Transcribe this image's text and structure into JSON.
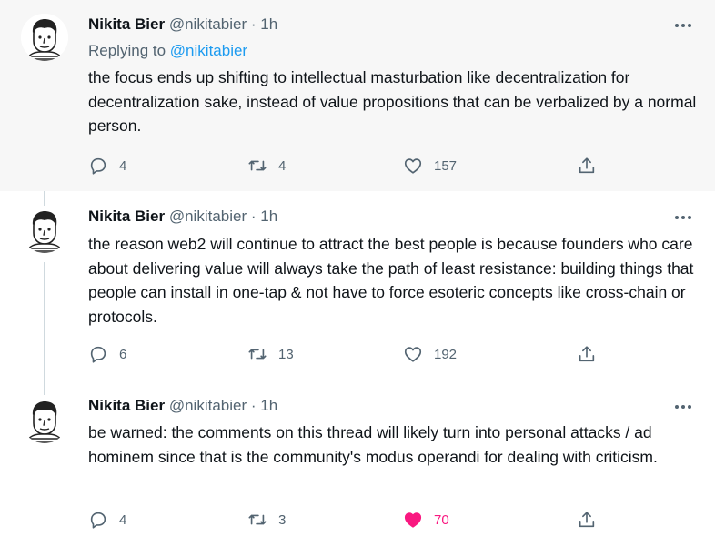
{
  "tweets": [
    {
      "author_name": "Nikita Bier",
      "handle": "@nikitabier",
      "separator": "·",
      "time": "1h",
      "replying_to_label": "Replying to",
      "replying_to_handle": "@nikitabier",
      "text": "the focus ends up shifting to intellectual masturbation like decentralization for decentralization sake, instead of value propositions that can be verbalized by a normal person.",
      "replies": "4",
      "retweets": "4",
      "likes": "157",
      "liked": false
    },
    {
      "author_name": "Nikita Bier",
      "handle": "@nikitabier",
      "separator": "·",
      "time": "1h",
      "text": "the reason web2 will continue to attract the best people is because founders who care about delivering value will always take the path of least resistance: building things that people can install in one-tap & not have to force esoteric concepts like cross-chain or protocols.",
      "replies": "6",
      "retweets": "13",
      "likes": "192",
      "liked": false
    },
    {
      "author_name": "Nikita Bier",
      "handle": "@nikitabier",
      "separator": "·",
      "time": "1h",
      "text": "be warned: the comments on this thread will likely turn into personal attacks / ad hominem since that is the community's modus operandi for dealing with criticism.",
      "replies": "4",
      "retweets": "3",
      "likes": "70",
      "liked": true
    }
  ],
  "icons": {
    "reply": "reply-icon",
    "retweet": "retweet-icon",
    "like": "heart-icon",
    "share": "share-icon",
    "more": "more-icon"
  },
  "colors": {
    "text": "#0f1419",
    "muted": "#536471",
    "link": "#1d9bf0",
    "like_active": "#f91880",
    "thread_line": "#cfd9de",
    "highlight_bg": "#f7f7f7"
  }
}
